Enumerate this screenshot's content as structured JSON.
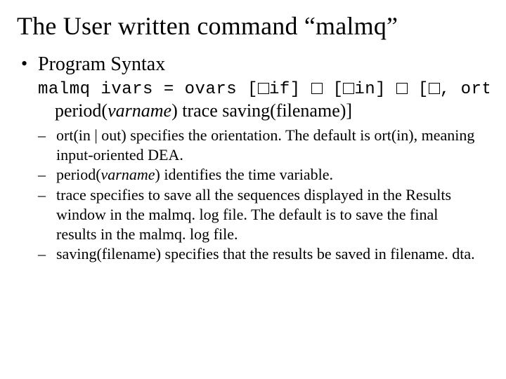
{
  "title": "The User written command “malmq”",
  "bullet1": "Program Syntax",
  "syntax_pre": "malmq ivars = ovars [",
  "syntax_if": "if] ",
  "syntax_in": "in] ",
  "syntax_comma_ort": ", ort",
  "syntax_line2_lead": "period(",
  "syntax_line2_var": "varname",
  "syntax_line2_rest": ") trace saving(filename)]",
  "subs": {
    "s1": "ort(in | out) specifies the orientation. The default is ort(in), meaning input-oriented DEA.",
    "s2a": "period(",
    "s2b": "varname",
    "s2c": ") identifies the time variable.",
    "s3": "trace specifies to save all the sequences displayed in the Results window in the malmq. log file. The default is to save the final results in the malmq. log file.",
    "s4": "saving(filename) specifies that the results be saved in filename. dta."
  }
}
